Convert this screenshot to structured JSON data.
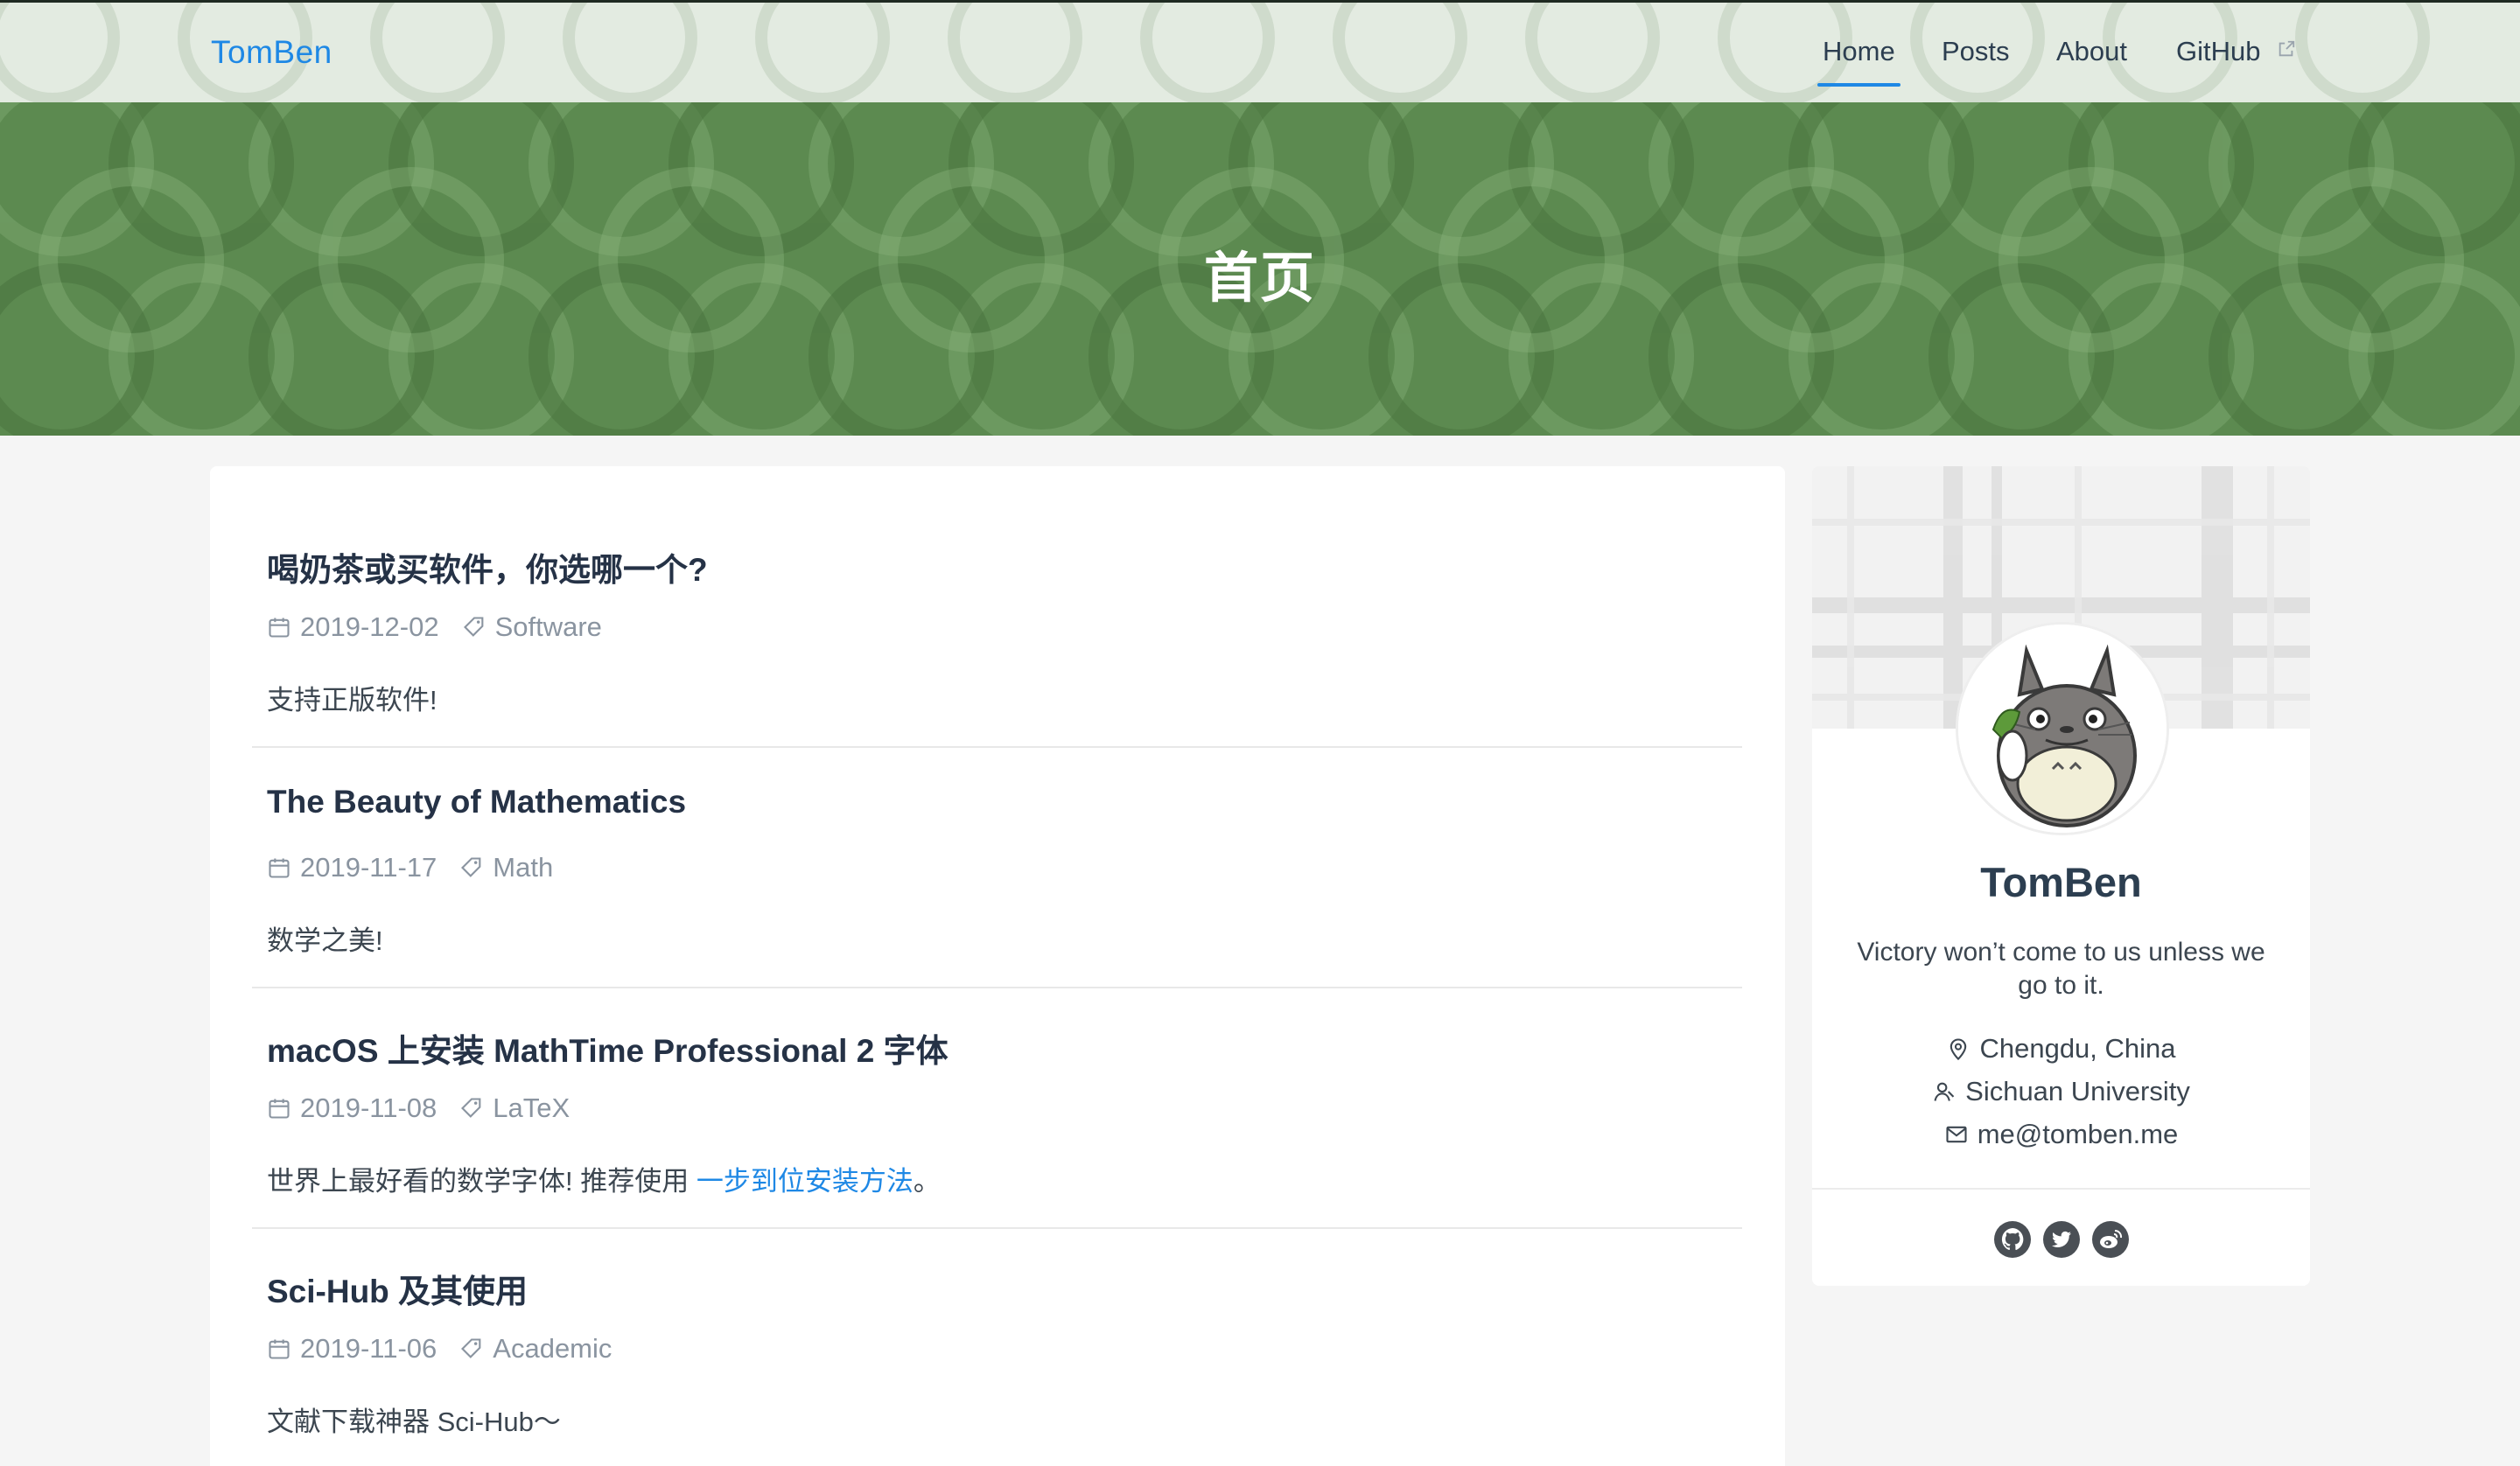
{
  "nav": {
    "brand": "TomBen",
    "items": [
      {
        "label": "Home",
        "active": true
      },
      {
        "label": "Posts",
        "active": false
      },
      {
        "label": "About",
        "active": false
      },
      {
        "label": "GitHub",
        "active": false,
        "external": true
      }
    ]
  },
  "hero": {
    "title": "首页"
  },
  "posts": [
    {
      "title": "喝奶茶或买软件，你选哪一个?",
      "date": "2019-12-02",
      "tag": "Software",
      "excerpt": "支持正版软件!"
    },
    {
      "title": "The Beauty of Mathematics",
      "date": "2019-11-17",
      "tag": "Math",
      "excerpt": "数学之美!"
    },
    {
      "title": "macOS 上安装 MathTime Professional 2 字体",
      "date": "2019-11-08",
      "tag": "LaTeX",
      "excerpt": "世界上最好看的数学字体! 推荐使用 ",
      "excerpt_link": "一步到位安装方法",
      "excerpt_tail": "。"
    },
    {
      "title": "Sci-Hub 及其使用",
      "date": "2019-11-06",
      "tag": "Academic",
      "excerpt": "文献下载神器 Sci-Hub〜"
    }
  ],
  "profile": {
    "name": "TomBen",
    "bio": "Victory won’t come to us unless we go to it.",
    "location": "Chengdu, China",
    "organization": "Sichuan University",
    "email": "me@tomben.me",
    "social_icons": [
      "github-icon",
      "twitter-icon",
      "weibo-icon"
    ]
  },
  "colors": {
    "accent": "#1e88e5",
    "hero_green": "#5c8a50",
    "text": "#2c3e50",
    "muted": "#8a94a0"
  }
}
